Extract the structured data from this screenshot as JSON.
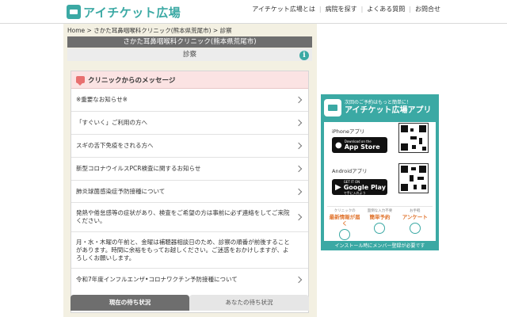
{
  "header": {
    "logo_text": "アイチケット広場",
    "nav": [
      "アイチケット広場とは",
      "病院を探す",
      "よくある質問",
      "お問合せ"
    ]
  },
  "breadcrumb": "Home > さかた耳鼻咽喉科クリニック(熊本県荒尾市) > 診察",
  "clinic_title": "さかた耳鼻咽喉科クリニック(熊本県荒尾市)",
  "section_title": "診察",
  "info_icon": "i",
  "messages": {
    "header": "クリニックからのメッセージ",
    "items": [
      "※重要なお知らせ※",
      "「すぐいく」ご利用の方へ",
      "スギの舌下免疫をされる方へ",
      "新型コロナウイルスPCR検査に関するお知らせ",
      "肺炎球菌感染症予防接種について",
      "発熱や倦怠感等の症状があり、検査をご希望の方は事前に必ず連絡をしてご来院ください。",
      "月・水・木曜の午前と、金曜は補聴器相談日のため、診察の順番が前後することがあります。時間に余裕をもってお越しください。ご迷惑をおかけしますが、よろしくお願いします。",
      "令和7年度インフルエンザ•コロナワクチン予防接種について"
    ]
  },
  "wait_tabs": {
    "current": "現在の待ち状況",
    "yours": "あなたの待ち状況"
  },
  "ad": {
    "tagline": "次回のご予約はもっと簡単に！",
    "title": "アイチケット広場アプリ",
    "iphone_label": "iPhoneアプリ",
    "appstore_small": "Download on the",
    "appstore_big": "App Store",
    "android_label": "Androidアプリ",
    "gplay_small": "GET IT ON",
    "gplay_big": "Google Play",
    "gplay_sub": "で手に入れよう",
    "features": [
      {
        "small": "クリニックの",
        "big": "最新情報が届く"
      },
      {
        "small": "面倒な入力不要",
        "big": "簡単予約"
      },
      {
        "small": "お手軽",
        "big": "アンケート"
      }
    ],
    "footer": "インストール時にメンバー登録が必要です"
  },
  "colors": {
    "brand": "#3ba9a4",
    "title_bar": "#6e6e6e",
    "message_header": "#fbe3e3",
    "main_background": "#f3f0e2",
    "feature_accent": "#e0742e"
  }
}
